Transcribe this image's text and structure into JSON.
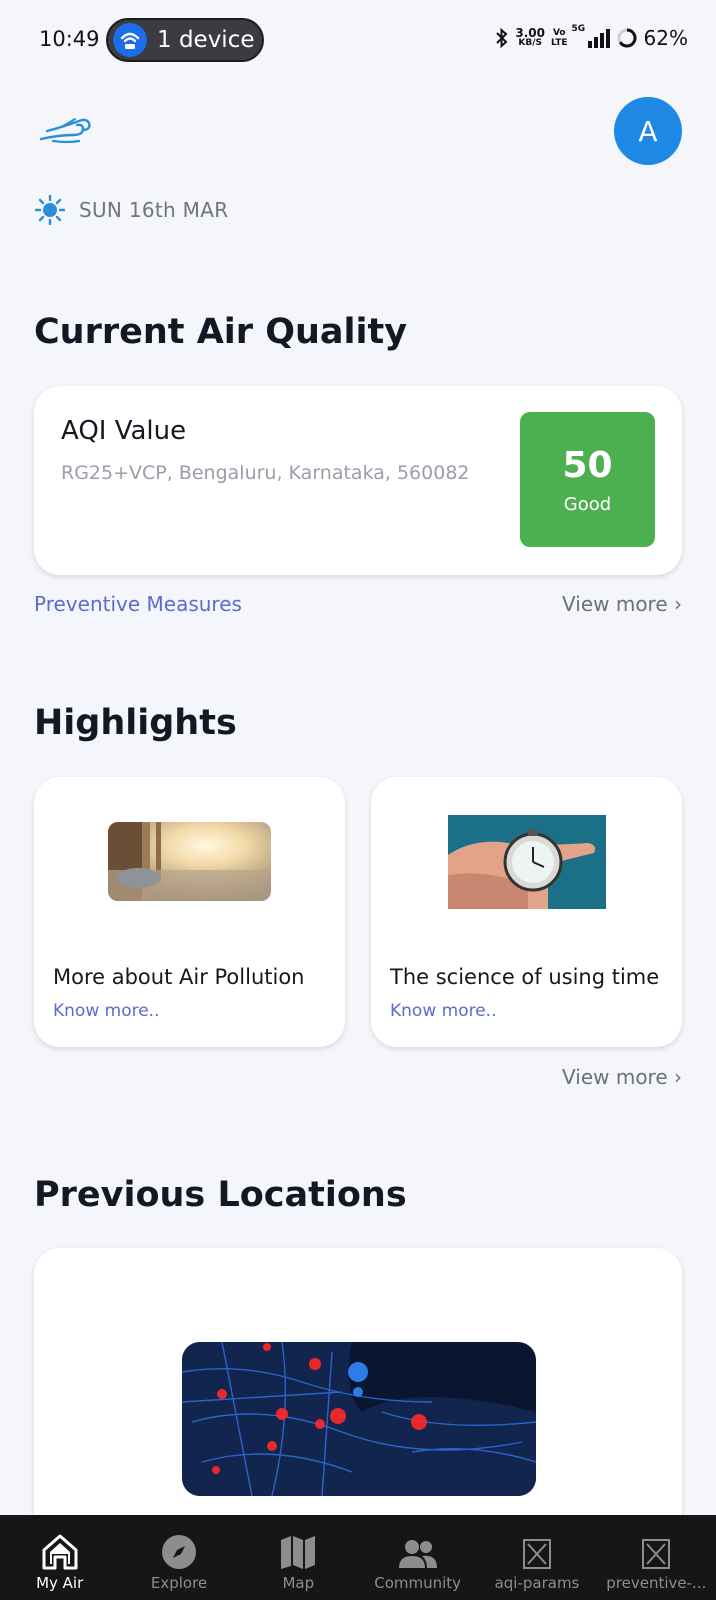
{
  "status_bar": {
    "time": "10:49",
    "device_pill": "1 device",
    "speed_value": "3.00",
    "speed_unit": "KB/S",
    "volte_top": "Vo",
    "volte_bottom": "LTE",
    "network": "5G",
    "battery": "62%"
  },
  "header": {
    "avatar_letter": "A",
    "date": "SUN 16th MAR"
  },
  "air_quality": {
    "heading": "Current Air Quality",
    "card_title": "AQI Value",
    "address": "RG25+VCP, Bengaluru, Karnataka, 560082",
    "aqi_value": "50",
    "aqi_label": "Good",
    "aqi_color": "#4caf50",
    "preventive_link": "Preventive Measures",
    "view_more": "View more ›"
  },
  "highlights": {
    "heading": "Highlights",
    "items": [
      {
        "title": "More about Air Pollution",
        "link": "Know more.."
      },
      {
        "title": "The science of using time",
        "link": "Know more.."
      }
    ],
    "view_more": "View more ›"
  },
  "previous_locations": {
    "heading": "Previous Locations"
  },
  "nav": {
    "items": [
      {
        "label": "My Air",
        "icon": "home-icon"
      },
      {
        "label": "Explore",
        "icon": "compass-icon"
      },
      {
        "label": "Map",
        "icon": "map-icon"
      },
      {
        "label": "Community",
        "icon": "people-icon"
      },
      {
        "label": "aqi-params",
        "icon": "broken-image-icon"
      },
      {
        "label": "preventive-...",
        "icon": "broken-image-icon"
      }
    ]
  },
  "colors": {
    "accent": "#1e88e5",
    "link": "#5b6bcf",
    "background": "#f4f6fb"
  }
}
